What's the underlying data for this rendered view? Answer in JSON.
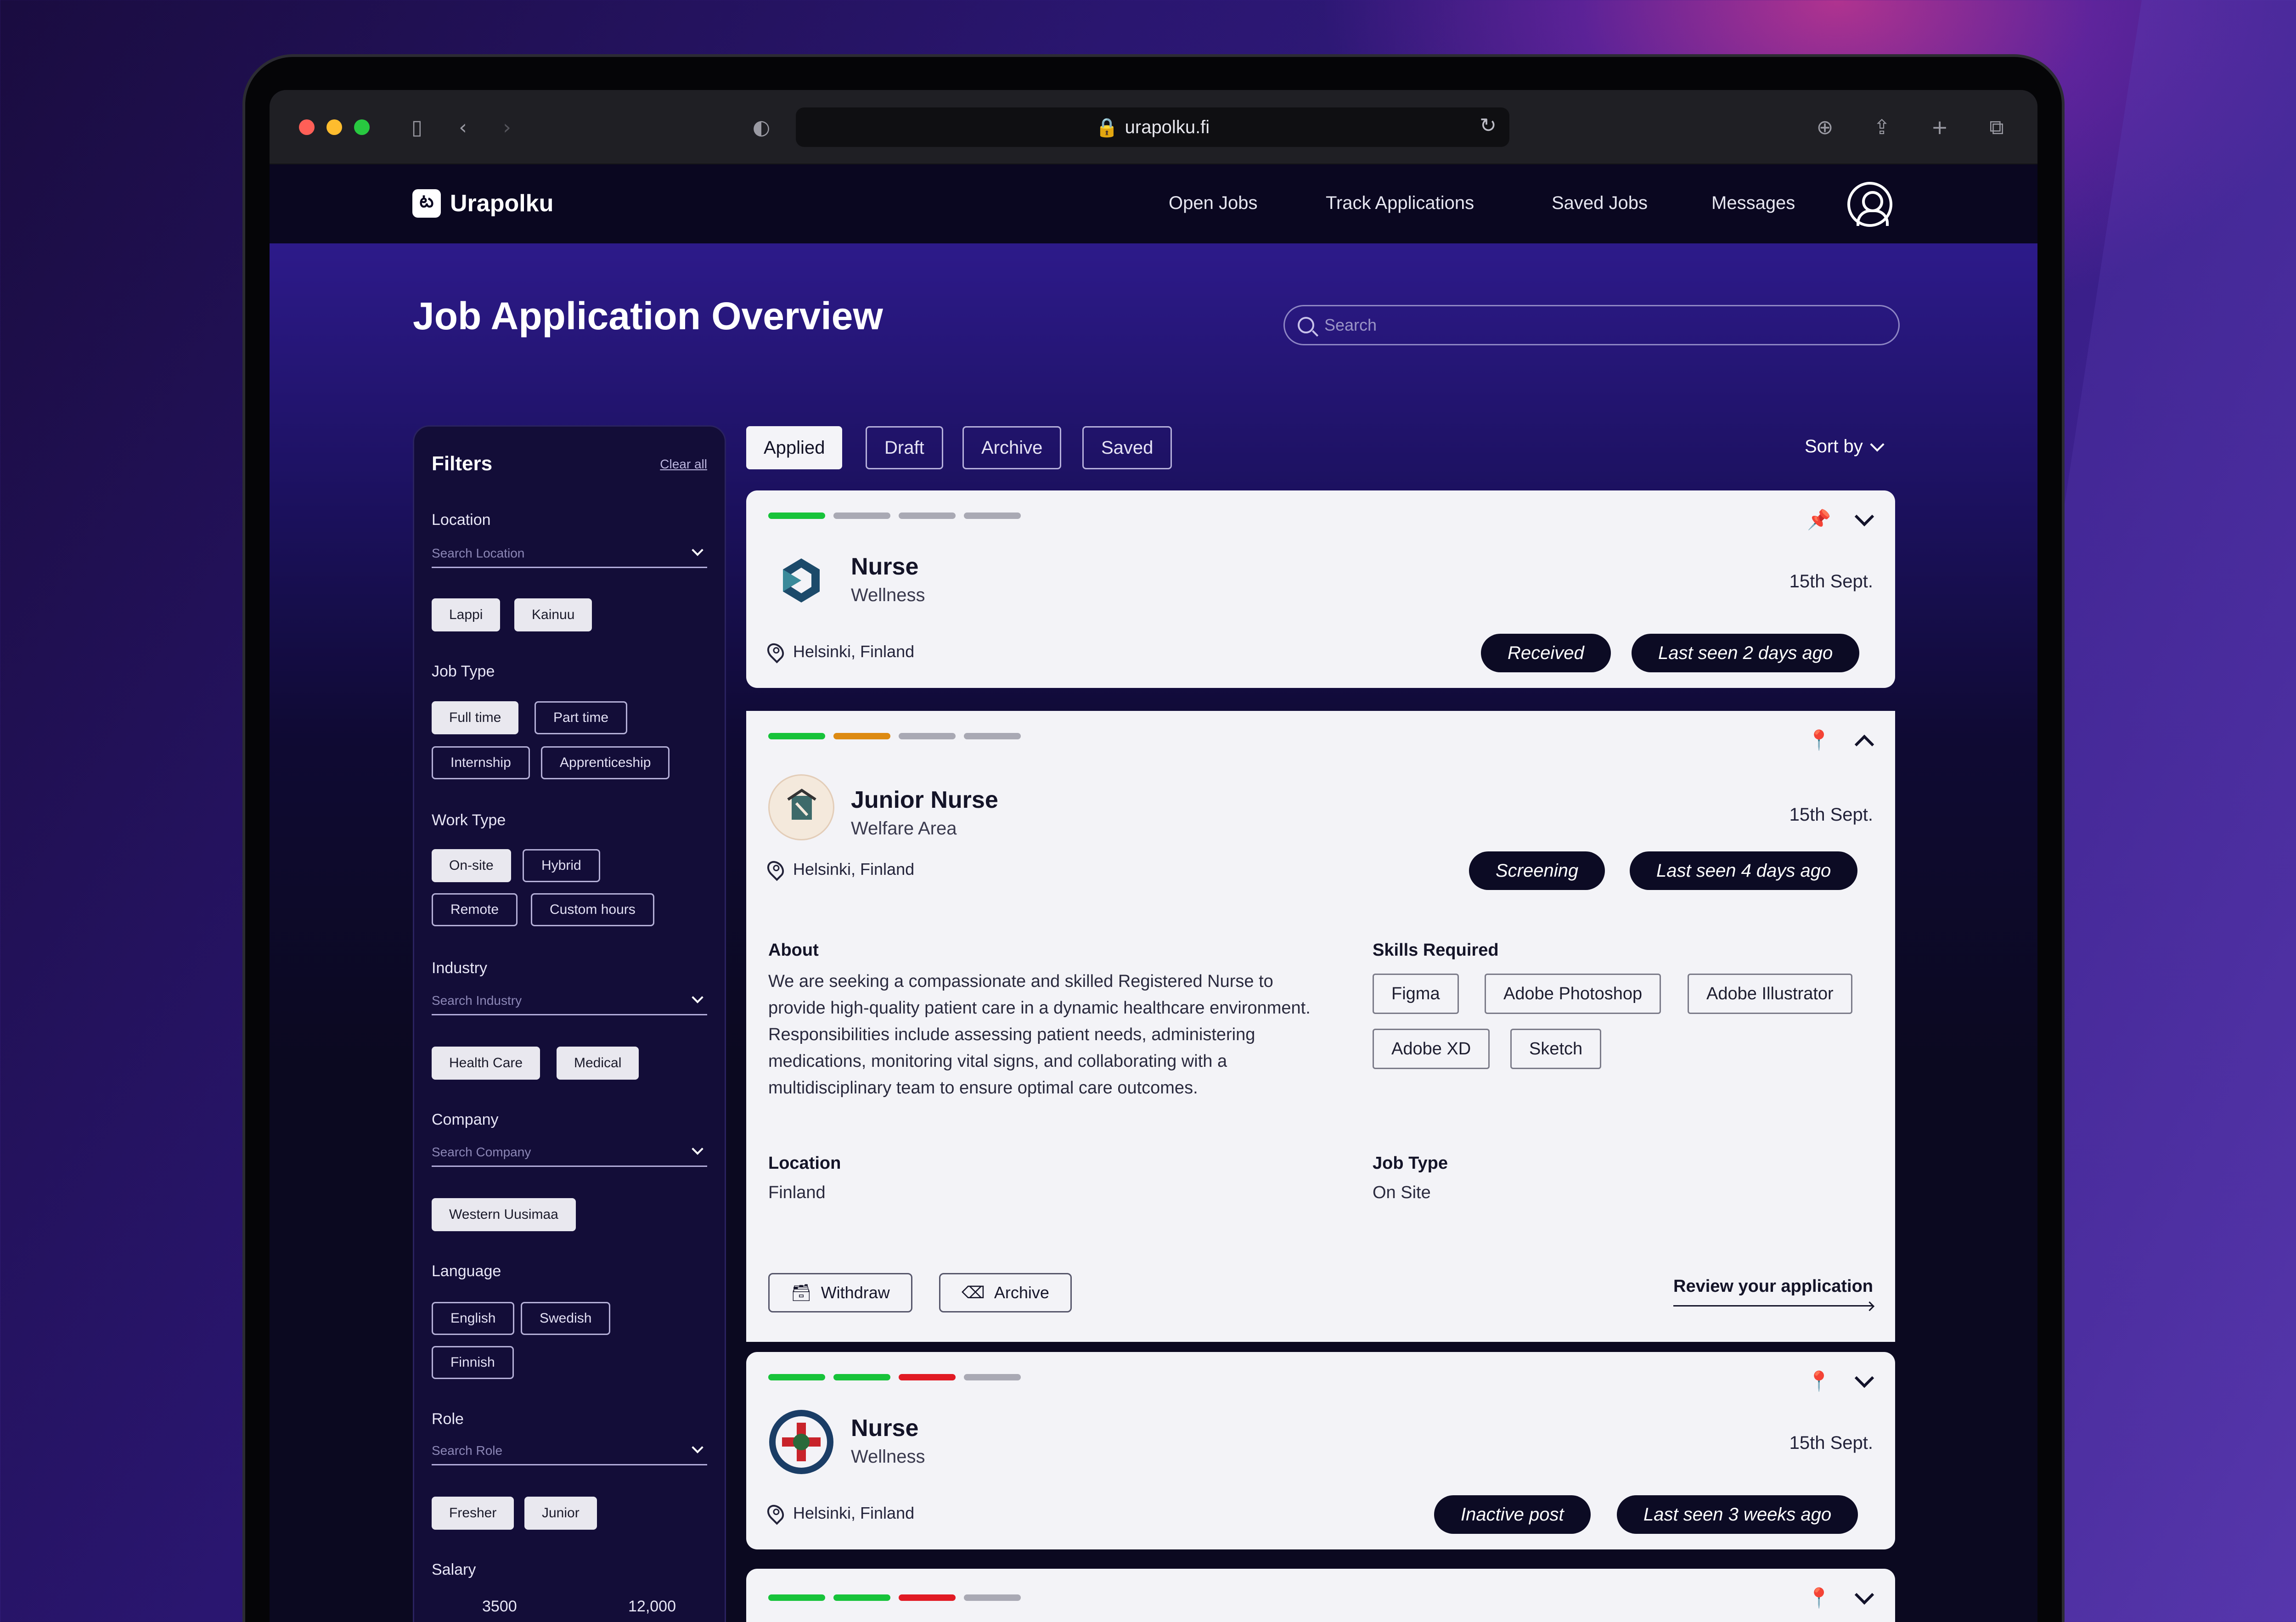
{
  "browser": {
    "url": "urapolku.fi"
  },
  "nav": {
    "brand": "Urapolku",
    "links": [
      "Open Jobs",
      "Track Applications",
      "Saved Jobs",
      "Messages"
    ]
  },
  "header": {
    "title": "Job Application Overview",
    "search_placeholder": "Search"
  },
  "filters": {
    "title": "Filters",
    "clear": "Clear all",
    "location": {
      "label": "Location",
      "placeholder": "Search Location",
      "chips": [
        "Lappi",
        "Kainuu"
      ]
    },
    "job_type": {
      "label": "Job Type",
      "chips": [
        "Full time",
        "Part time",
        "Internship",
        "Apprenticeship"
      ]
    },
    "work_type": {
      "label": "Work Type",
      "chips": [
        "On-site",
        "Hybrid",
        "Remote",
        "Custom hours"
      ]
    },
    "industry": {
      "label": "Industry",
      "placeholder": "Search Industry",
      "chips": [
        "Health Care",
        "Medical"
      ]
    },
    "company": {
      "label": "Company",
      "placeholder": "Search Company",
      "chips": [
        "Western Uusimaa"
      ]
    },
    "language": {
      "label": "Language",
      "chips": [
        "English",
        "Swedish",
        "Finnish"
      ]
    },
    "role": {
      "label": "Role",
      "placeholder": "Search Role",
      "chips": [
        "Fresher",
        "Junior"
      ]
    },
    "salary": {
      "label": "Salary",
      "min": "3500",
      "max": "12,000"
    }
  },
  "tabs": [
    "Applied",
    "Draft",
    "Archive",
    "Saved"
  ],
  "sort_label": "Sort by",
  "cards": [
    {
      "title": "Nurse",
      "company": "Wellness",
      "date": "15th Sept.",
      "location": "Helsinki, Finland",
      "status": "Received",
      "last_seen": "Last seen 2 days ago"
    },
    {
      "title": "Junior Nurse",
      "company": "Welfare Area",
      "date": "15th Sept.",
      "location": "Helsinki, Finland",
      "status": "Screening",
      "last_seen": "Last seen 4 days ago",
      "about_label": "About",
      "about": "We are seeking a compassionate and skilled Registered Nurse to provide high-quality patient care in a dynamic healthcare environment. Responsibilities include assessing patient needs, administering medications, monitoring vital signs, and collaborating with a multidisciplinary team to ensure optimal care outcomes.",
      "skills_label": "Skills Required",
      "skills": [
        "Figma",
        "Adobe Photoshop",
        "Adobe Illustrator",
        "Adobe XD",
        "Sketch"
      ],
      "location_label": "Location",
      "location_value": "Finland",
      "job_type_label": "Job Type",
      "job_type_value": "On Site",
      "withdraw": "Withdraw",
      "archive": "Archive",
      "review": "Review your application"
    },
    {
      "title": "Nurse",
      "company": "Wellness",
      "date": "15th Sept.",
      "location": "Helsinki, Finland",
      "status": "Inactive post",
      "last_seen": "Last seen 3 weeks ago"
    }
  ],
  "colors": {
    "progress_green": "#17c33a",
    "progress_orange": "#dd8a12",
    "progress_red": "#e11a24",
    "progress_gray": "#a9a9b4"
  }
}
